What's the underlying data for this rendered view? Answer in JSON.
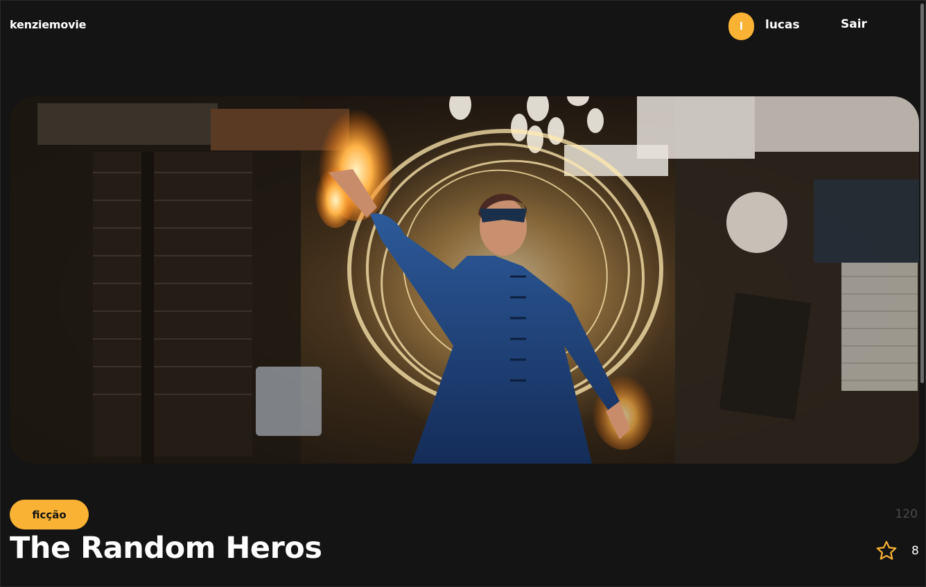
{
  "header": {
    "logo": "kenziemovie",
    "avatar_initial": "l",
    "username": "lucas",
    "logout_label": "Sair"
  },
  "banner": {
    "icon": "movie-banner-image"
  },
  "movie": {
    "genre": "ficção",
    "duration": "120",
    "title": "The Random Heros",
    "rating": "8",
    "rating_icon": "star-icon"
  },
  "colors": {
    "background": "#141414",
    "accent": "#f9b233",
    "text": "#ffffff",
    "muted": "#4a4a4a"
  }
}
